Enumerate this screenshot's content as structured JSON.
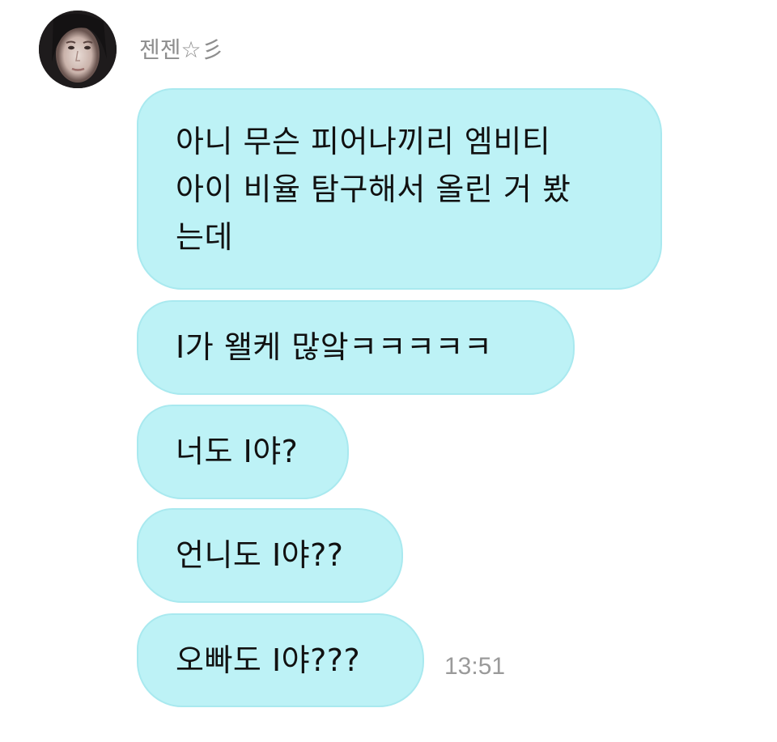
{
  "conversation": {
    "sender_name": "젠젠☆彡",
    "avatar_icon": "profile-photo-icon",
    "bubble_color": "#bdf2f6",
    "messages": [
      {
        "text": "아니 무슨 피어나끼리 엠비티\n아이 비율 탐구해서 올린 거 봤\n는데"
      },
      {
        "text": "I가 왤케 많앜ㅋㅋㅋㅋㅋ"
      },
      {
        "text": "너도 I야?"
      },
      {
        "text": "언니도 I야??"
      },
      {
        "text": "오빠도 I야???"
      }
    ],
    "timestamp": "13:51"
  }
}
